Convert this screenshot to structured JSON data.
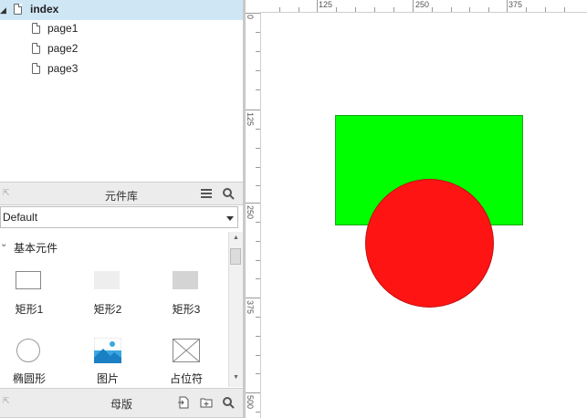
{
  "pages": {
    "root": "index",
    "children": [
      "page1",
      "page2",
      "page3"
    ]
  },
  "library": {
    "title": "元件库",
    "selected": "Default",
    "section": "基本元件",
    "widgets": [
      "矩形1",
      "矩形2",
      "矩形3",
      "椭圆形",
      "图片",
      "占位符"
    ]
  },
  "masters": {
    "title": "母版"
  },
  "ruler": {
    "top_labels": [
      "125",
      "250",
      "375"
    ],
    "left_labels": [
      "0",
      "125",
      "250",
      "375",
      "500"
    ]
  },
  "canvas": {
    "rect_color": "#00ff00",
    "circle_color": "#ff1414"
  }
}
